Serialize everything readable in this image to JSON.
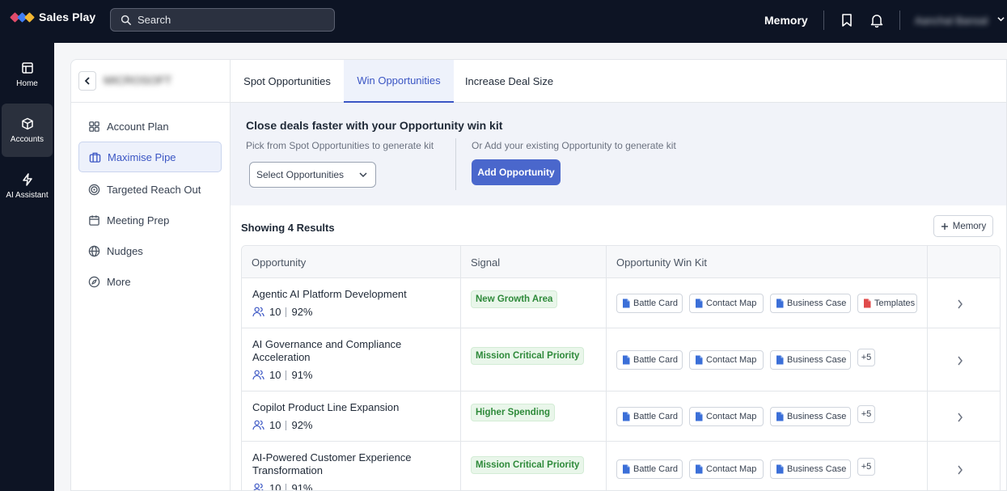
{
  "app": {
    "name": "Sales Play"
  },
  "search": {
    "placeholder": "Search"
  },
  "topbar": {
    "memory_label": "Memory",
    "user_name": "Aanchal Bansal"
  },
  "rail": [
    {
      "label": "Home",
      "icon": "home-icon"
    },
    {
      "label": "Accounts",
      "icon": "box-icon"
    },
    {
      "label": "AI Assistant",
      "icon": "bolt-icon"
    }
  ],
  "account": {
    "name": "MICROSOFT"
  },
  "subnav": [
    {
      "label": "Account Plan",
      "icon": "grid-icon"
    },
    {
      "label": "Maximise Pipe",
      "icon": "briefcase-icon"
    },
    {
      "label": "Targeted Reach Out",
      "icon": "target-icon"
    },
    {
      "label": "Meeting Prep",
      "icon": "calendar-icon"
    },
    {
      "label": "Nudges",
      "icon": "globe-icon"
    },
    {
      "label": "More",
      "icon": "compass-icon"
    }
  ],
  "tabs": [
    {
      "label": "Spot Opportunities"
    },
    {
      "label": "Win Opportunities"
    },
    {
      "label": "Increase Deal Size"
    }
  ],
  "kit": {
    "title": "Close deals faster with your Opportunity win kit",
    "pick_text": "Pick from Spot Opportunities to generate kit",
    "add_text": "Or Add your existing Opportunity to generate kit",
    "select_label": "Select Opportunities",
    "add_button": "Add Opportunity"
  },
  "results": {
    "label": "Showing 4 Results",
    "memory_button": "Memory"
  },
  "table": {
    "headers": [
      "Opportunity",
      "Signal",
      "Opportunity Win Kit",
      ""
    ],
    "rows": [
      {
        "name": "Agentic AI Platform Development",
        "contacts": "10",
        "score": "92%",
        "signal": "New Growth Area",
        "kit": [
          "Battle Card",
          "Contact Map",
          "Business Case",
          "Templates"
        ],
        "more": ""
      },
      {
        "name": "AI Governance and Compliance Acceleration",
        "contacts": "10",
        "score": "91%",
        "signal": "Mission Critical Priority",
        "kit": [
          "Battle Card",
          "Contact Map",
          "Business Case"
        ],
        "more": "+5"
      },
      {
        "name": "Copilot Product Line Expansion",
        "contacts": "10",
        "score": "92%",
        "signal": "Higher Spending",
        "kit": [
          "Battle Card",
          "Contact Map",
          "Business Case"
        ],
        "more": "+5"
      },
      {
        "name": "AI-Powered Customer Experience Transformation",
        "contacts": "10",
        "score": "91%",
        "signal": "Mission Critical Priority",
        "kit": [
          "Battle Card",
          "Contact Map",
          "Business Case"
        ],
        "more": "+5"
      }
    ]
  },
  "colors": {
    "accent": "#3b56c4",
    "button": "#4a67cc",
    "signal_green": "#2e8a3a",
    "topbar": "#0d1424"
  }
}
